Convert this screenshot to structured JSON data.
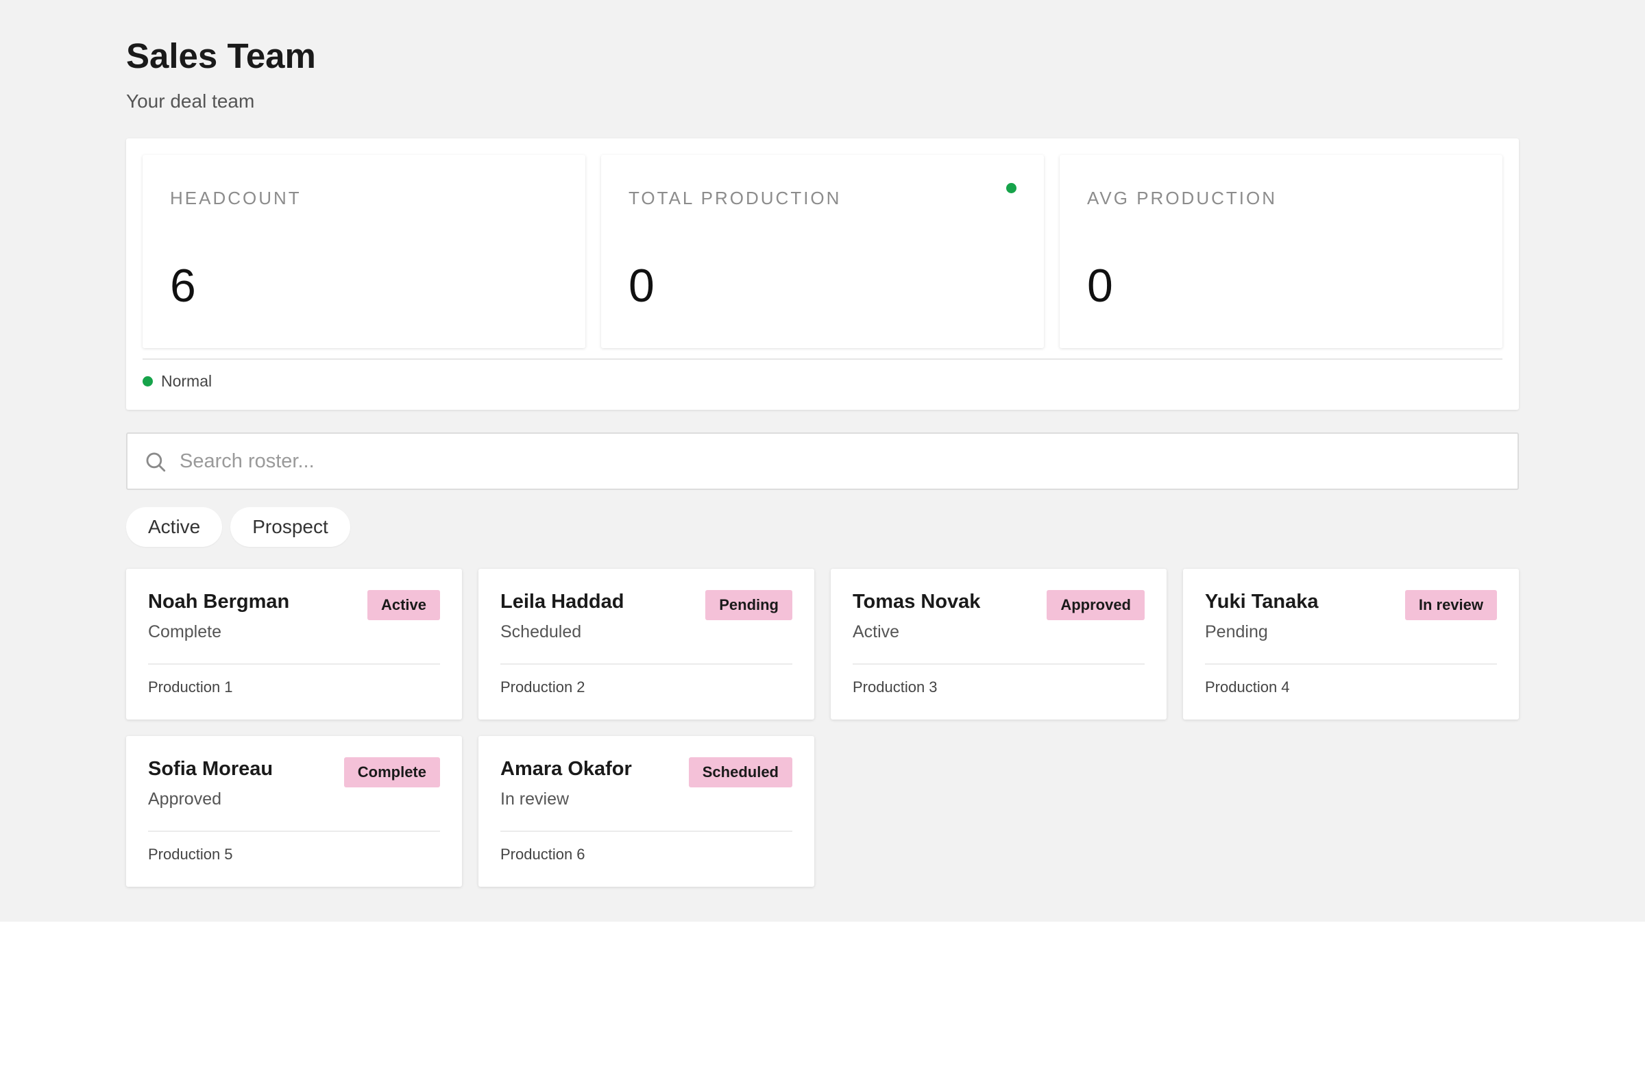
{
  "header": {
    "title": "Sales Team",
    "subtitle": "Your deal team"
  },
  "colors": {
    "page_background": "#f2f2f2",
    "status_green": "#16a34a",
    "badge_pink": "#f4c1d8"
  },
  "stats": [
    {
      "label": "HEADCOUNT",
      "value": "6"
    },
    {
      "label": "TOTAL PRODUCTION",
      "value": "0",
      "indicator": "green-dot"
    },
    {
      "label": "AVG PRODUCTION",
      "value": "0"
    }
  ],
  "status": {
    "text": "Normal"
  },
  "search": {
    "placeholder": "Search roster...",
    "value": "",
    "icon": "search-icon"
  },
  "filters": [
    {
      "label": "Active"
    },
    {
      "label": "Prospect"
    }
  ],
  "members": [
    {
      "name": "Noah Bergman",
      "status": "Complete",
      "badge": "Active",
      "footer": "Production 1"
    },
    {
      "name": "Leila Haddad",
      "status": "Scheduled",
      "badge": "Pending",
      "footer": "Production 2"
    },
    {
      "name": "Tomas Novak",
      "status": "Active",
      "badge": "Approved",
      "footer": "Production 3"
    },
    {
      "name": "Yuki Tanaka",
      "status": "Pending",
      "badge": "In review",
      "footer": "Production 4"
    },
    {
      "name": "Sofia Moreau",
      "status": "Approved",
      "badge": "Complete",
      "footer": "Production 5"
    },
    {
      "name": "Amara Okafor",
      "status": "In review",
      "badge": "Scheduled",
      "footer": "Production 6"
    }
  ]
}
